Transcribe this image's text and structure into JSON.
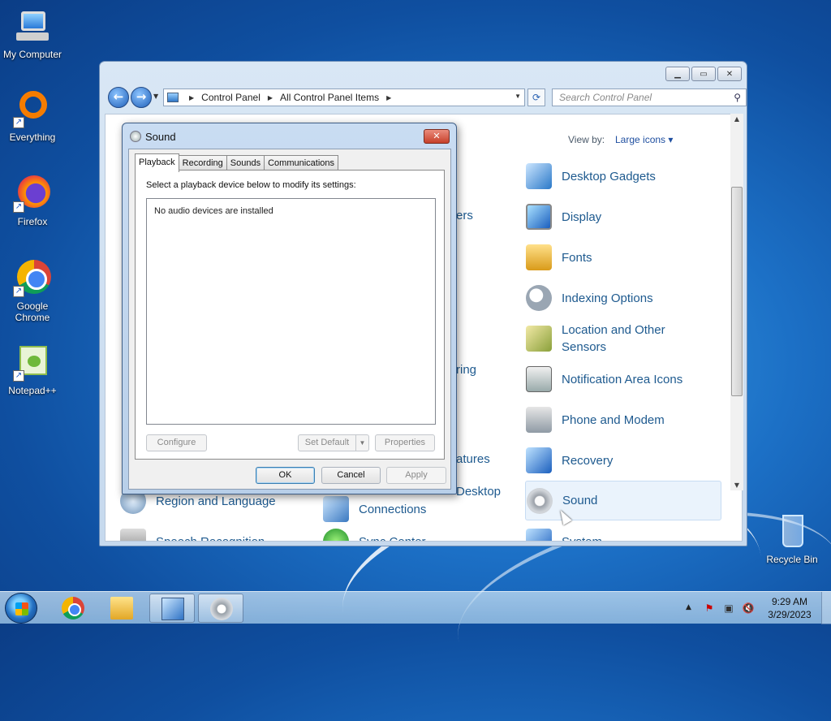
{
  "desktop": {
    "icons": [
      {
        "label": "My Computer",
        "icon": "computer-icon"
      },
      {
        "label": "Everything",
        "icon": "everything-search-icon"
      },
      {
        "label": "Firefox",
        "icon": "firefox-icon"
      },
      {
        "label": "Google Chrome",
        "icon": "chrome-icon"
      },
      {
        "label": "Notepad++",
        "icon": "notepadpp-icon"
      },
      {
        "label": "Recycle Bin",
        "icon": "recycle-bin-icon"
      }
    ]
  },
  "control_panel": {
    "breadcrumb": [
      "Control Panel",
      "All Control Panel Items"
    ],
    "search_placeholder": "Search Control Panel",
    "view_by_label": "View by:",
    "view_by_value": "Large icons ▾",
    "items_right": [
      {
        "label": "Desktop Gadgets",
        "icon": "gadgets-icon"
      },
      {
        "label": "Display",
        "icon": "display-icon"
      },
      {
        "label": "Fonts",
        "icon": "fonts-icon"
      },
      {
        "label": "Indexing Options",
        "icon": "indexing-icon"
      },
      {
        "label": "Location and Other Sensors",
        "icon": "location-sensors-icon"
      },
      {
        "label": "Notification Area Icons",
        "icon": "notification-icon"
      },
      {
        "label": "Phone and Modem",
        "icon": "phone-modem-icon"
      },
      {
        "label": "Recovery",
        "icon": "recovery-icon"
      },
      {
        "label": "Sound",
        "icon": "sound-icon"
      },
      {
        "label": "System",
        "icon": "system-icon"
      }
    ],
    "items_left_bottom": [
      {
        "label": "Region and Language",
        "icon": "region-icon"
      },
      {
        "label": "Speech Recognition",
        "icon": "speech-icon"
      }
    ],
    "items_mid_bottom": [
      {
        "label": "Connections",
        "icon": "remote-icon"
      },
      {
        "label": "Sync Center",
        "icon": "sync-icon"
      }
    ],
    "partial_texts": [
      "ers",
      "ring",
      "atures",
      "Desktop"
    ]
  },
  "sound_dialog": {
    "title": "Sound",
    "tabs": [
      "Playback",
      "Recording",
      "Sounds",
      "Communications"
    ],
    "active_tab": "Playback",
    "instruction": "Select a playback device below to modify its settings:",
    "empty_message": "No audio devices are installed",
    "buttons": {
      "configure": "Configure",
      "set_default": "Set Default",
      "properties": "Properties",
      "ok": "OK",
      "cancel": "Cancel",
      "apply": "Apply"
    }
  },
  "taskbar": {
    "clock_time": "9:29 AM",
    "clock_date": "3/29/2023"
  }
}
